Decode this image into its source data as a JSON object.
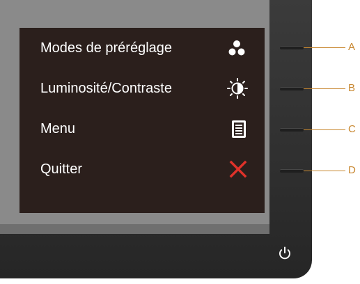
{
  "osd_menu": {
    "items": [
      {
        "label": "Modes de préréglage",
        "icon": "preset-modes-icon"
      },
      {
        "label": "Luminosité/Contraste",
        "icon": "brightness-contrast-icon"
      },
      {
        "label": "Menu",
        "icon": "menu-document-icon"
      },
      {
        "label": "Quitter",
        "icon": "close-x-icon"
      }
    ]
  },
  "hardware_buttons": {
    "labels": [
      "A",
      "B",
      "C",
      "D"
    ],
    "power_icon": "power-icon"
  },
  "colors": {
    "osd_background": "#2b1f1c",
    "label_text": "#ffffff",
    "exit_red": "#e0322a",
    "leader_line": "#c8872f"
  }
}
